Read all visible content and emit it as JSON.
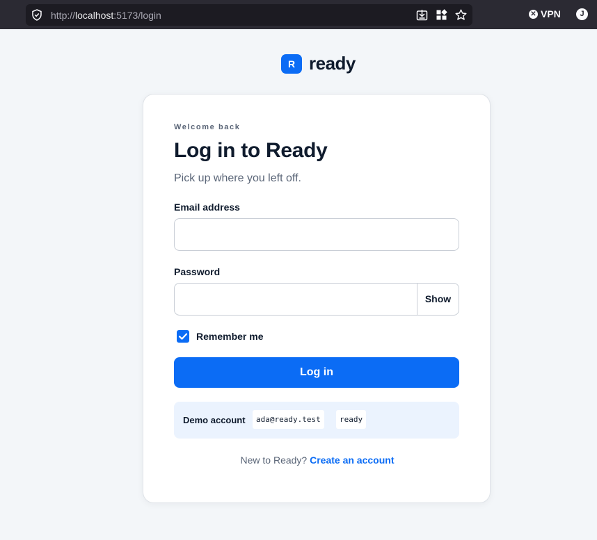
{
  "browser": {
    "url_prefix": "http://",
    "url_host": "localhost",
    "url_path": ":5173/login",
    "vpn_label": "VPN",
    "profile_initial": "J"
  },
  "brand": {
    "mark": "R",
    "name": "ready",
    "accent_color": "#0b6cf5"
  },
  "login": {
    "eyebrow": "Welcome back",
    "title": "Log in to Ready",
    "subtitle": "Pick up where you left off.",
    "email_label": "Email address",
    "email_value": "",
    "password_label": "Password",
    "password_value": "",
    "show_label": "Show",
    "remember_label": "Remember me",
    "remember_checked": true,
    "submit_label": "Log in"
  },
  "demo": {
    "label": "Demo account",
    "email": "ada@ready.test",
    "password": "ready"
  },
  "footer": {
    "prompt": "New to Ready?",
    "link": "Create an account"
  }
}
